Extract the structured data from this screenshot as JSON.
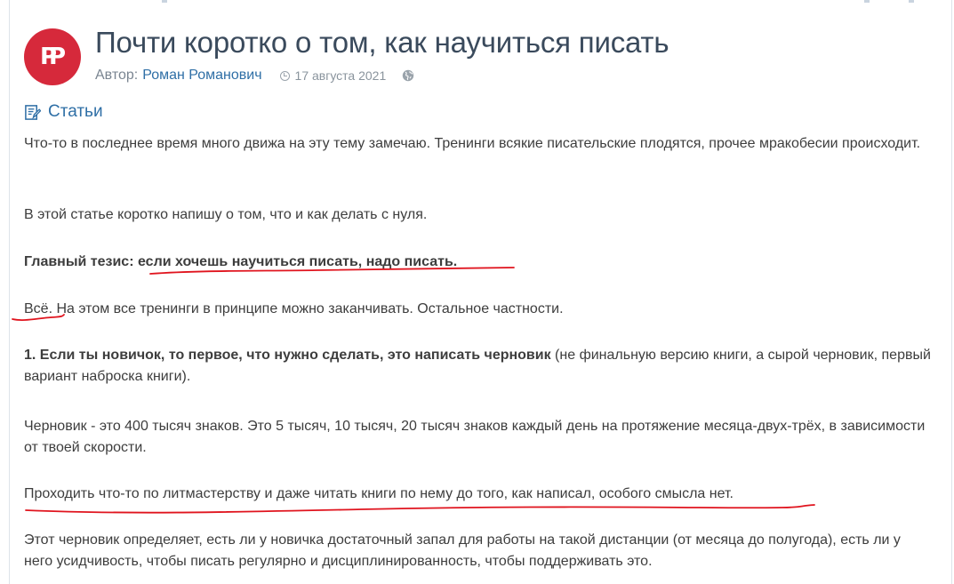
{
  "article": {
    "avatar_initials": "РР",
    "title": "Почти коротко о том, как научиться писать",
    "author_label": "Автор:",
    "author_name": "Роман Романович",
    "date": "17 августа 2021",
    "category": "Статьи"
  },
  "paragraphs": {
    "p1": "Что-то в последнее время много движа на эту тему замечаю. Тренинги всякие писательские плодятся, прочее мракобесии происходит.",
    "p2": "В этой статье коротко напишу о том, что и как делать с нуля.",
    "p3_bold_prefix": "Главный тезис: ",
    "p3_bold_highlight": "если хочешь научиться писать, надо писать",
    "p3_bold_suffix": ".",
    "p4_highlight": "Всё.",
    "p4_rest": " На этом все тренинги в принципе можно заканчивать. Остальное частности.",
    "p5_bold": "1. Если ты новичок, то первое, что нужно сделать, это написать черновик",
    "p5_rest": " (не финальную версию книги, а сырой черновик, первый вариант наброска книги).",
    "p6": "Черновик - это 400 тысяч знаков. Это 5 тысяч, 10 тысяч, 20 тысяч знаков каждый день на протяжение месяца-двух-трёх, в зависимости от твоей скорости.",
    "p7": "Проходить что-то по литмастерству и даже читать книги по нему до того, как написал, особого смысла нет.",
    "p8": "Этот черновик определяет, есть ли у новичка достаточный запал для работы на такой дистанции (от месяца до полугода), есть ли у него усидчивость, чтобы писать регулярно и дисциплинированность, чтобы поддерживать это."
  },
  "colors": {
    "accent_link": "#2f6fa6",
    "avatar_bg": "#d6293b",
    "underline_red": "#e0141e"
  },
  "icons": {
    "clock": "clock-icon",
    "globe": "globe-icon",
    "category": "edit-note-icon"
  }
}
